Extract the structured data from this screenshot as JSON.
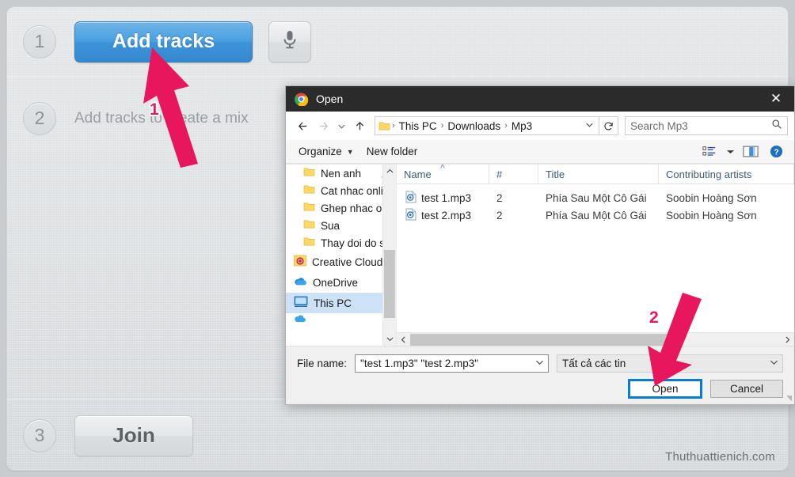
{
  "app": {
    "steps": [
      {
        "number": "1",
        "add_tracks_label": "Add tracks",
        "mic_icon": "microphone-icon"
      },
      {
        "number": "2",
        "hint": "Add tracks to create a mix"
      },
      {
        "number": "3",
        "join_label": "Join"
      }
    ],
    "watermark": "Thuthuattienich.com"
  },
  "dialog": {
    "title": "Open",
    "title_icon": "chrome-icon",
    "close_icon": "close-icon",
    "nav": {
      "back_icon": "arrow-left-icon",
      "forward_icon": "arrow-right-icon",
      "recent_icon": "chevron-down-icon",
      "up_icon": "arrow-up-icon",
      "folder_icon": "folder-icon",
      "breadcrumbs": [
        "This PC",
        "Downloads",
        "Mp3"
      ],
      "separator": "›",
      "dropdown_icon": "chevron-down-icon",
      "refresh_icon": "refresh-icon"
    },
    "search": {
      "placeholder": "Search Mp3",
      "icon": "search-icon"
    },
    "toolbar": {
      "organize_label": "Organize",
      "new_folder_label": "New folder",
      "view_icon": "view-list-icon",
      "view_caret_icon": "chevron-down-icon",
      "preview_icon": "preview-pane-icon",
      "help_icon": "help-icon"
    },
    "navpane": {
      "items": [
        {
          "label": "Nen anh",
          "icon": "folder-icon",
          "indent": true,
          "pinned": true,
          "selected": false
        },
        {
          "label": "Cat nhac online",
          "icon": "folder-icon",
          "indent": true,
          "pinned": false,
          "selected": false
        },
        {
          "label": "Ghep nhac onlin",
          "icon": "folder-icon",
          "indent": true,
          "pinned": false,
          "selected": false
        },
        {
          "label": "Sua",
          "icon": "folder-icon",
          "indent": true,
          "pinned": false,
          "selected": false
        },
        {
          "label": "Thay doi do sang",
          "icon": "folder-icon",
          "indent": true,
          "pinned": false,
          "selected": false
        },
        {
          "label": "Creative Cloud Fil",
          "icon": "creative-cloud-icon",
          "indent": false,
          "pinned": false,
          "selected": false
        },
        {
          "label": "OneDrive",
          "icon": "onedrive-icon",
          "indent": false,
          "pinned": false,
          "selected": false
        },
        {
          "label": "This PC",
          "icon": "this-pc-icon",
          "indent": false,
          "pinned": false,
          "selected": true
        }
      ],
      "scroll_up_icon": "chevron-up-icon",
      "scroll_down_icon": "chevron-down-icon"
    },
    "filelist": {
      "columns": [
        "Name",
        "#",
        "Title",
        "Contributing artists"
      ],
      "sort_column": "Name",
      "sort_indicator": "˄",
      "rows": [
        {
          "icon": "mp3-file-icon",
          "name": "test 1.mp3",
          "num": "2",
          "title": "Phía Sau Một Cô Gái",
          "artist": "Soobin Hoàng Sơn"
        },
        {
          "icon": "mp3-file-icon",
          "name": "test 2.mp3",
          "num": "2",
          "title": "Phía Sau Một Cô Gái",
          "artist": "Soobin Hoàng Sơn"
        }
      ],
      "hscroll_left_icon": "chevron-left-icon",
      "hscroll_right_icon": "chevron-right-icon"
    },
    "footer": {
      "filename_label": "File name:",
      "filename_value": "\"test 1.mp3\" \"test 2.mp3\"",
      "filename_caret_icon": "chevron-down-icon",
      "filetype_value": "Tất cả các tin",
      "filetype_caret_icon": "chevron-down-icon",
      "open_label": "Open",
      "cancel_label": "Cancel"
    }
  },
  "annotations": {
    "color": "#e8175d",
    "markers": [
      {
        "label": "1",
        "target": "add-tracks-button"
      },
      {
        "label": "2",
        "target": "open-button"
      }
    ]
  }
}
